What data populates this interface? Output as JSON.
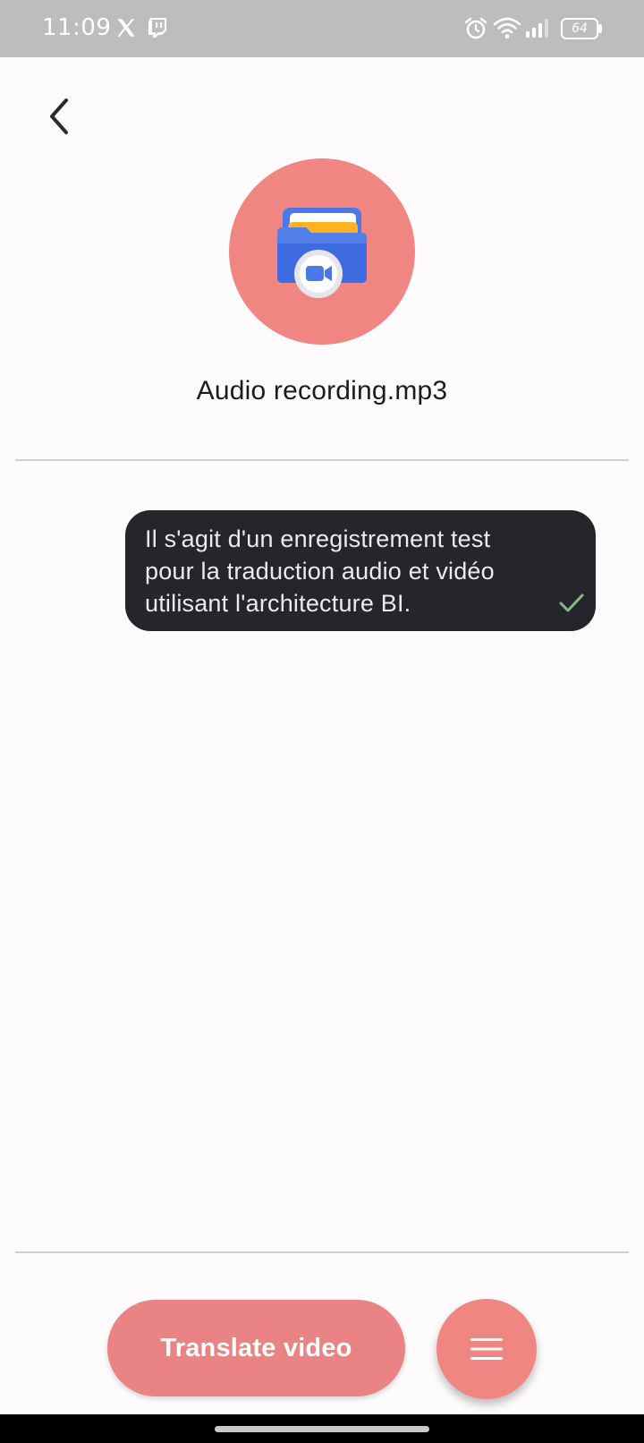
{
  "status_bar": {
    "time": "11:09",
    "battery": "64",
    "icons": [
      "x-icon",
      "twitch-icon",
      "alarm-icon",
      "wifi-icon",
      "signal-icon",
      "battery-icon"
    ]
  },
  "header": {
    "back_icon": "chevron-left-icon"
  },
  "file": {
    "icon": "video-folder-icon",
    "name": "Audio recording.mp3"
  },
  "messages": [
    {
      "text": "Il s'agit d'un enregistrement test pour la traduction audio et vidéo utilisant l'architecture BI.",
      "status_icon": "check-icon"
    }
  ],
  "actions": {
    "translate_label": "Translate video",
    "menu_icon": "hamburger-menu-icon"
  },
  "colors": {
    "accent": "#f08682",
    "button": "#ea8383",
    "bubble": "#24262b",
    "status_bar": "#bdbdbd"
  }
}
